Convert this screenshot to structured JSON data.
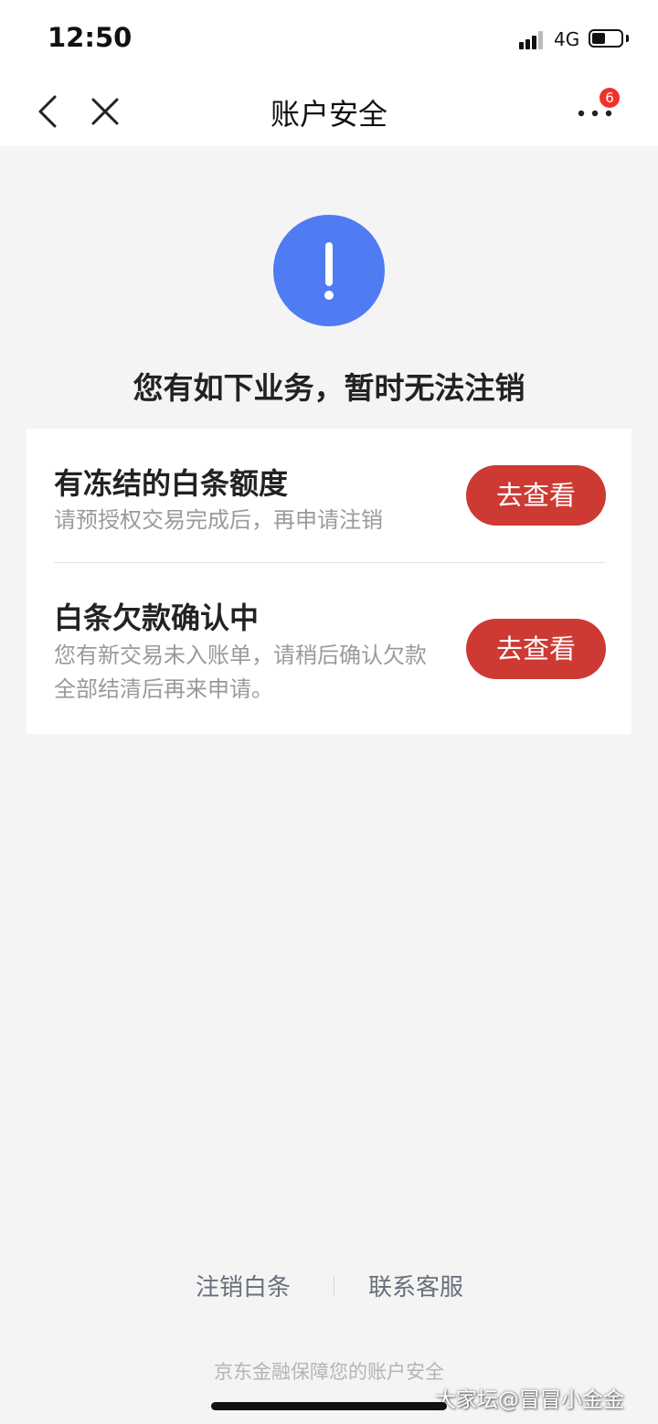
{
  "status_bar": {
    "time": "12:50",
    "network": "4G"
  },
  "nav": {
    "title": "账户安全",
    "badge_count": "6"
  },
  "alert": {
    "icon": "exclamation-icon",
    "icon_color": "#4f7cf2",
    "headline": "您有如下业务，暂时无法注销"
  },
  "items": [
    {
      "title": "有冻结的白条额度",
      "desc_lines": [
        "请预授权交易完成后，再申请注销"
      ],
      "action": "去查看"
    },
    {
      "title": "白条欠款确认中",
      "desc_lines": [
        "您有新交易未入账单，请稍后确认欠款",
        "全部结清后再来申请。"
      ],
      "action": "去查看"
    }
  ],
  "footer": {
    "link_cancel": "注销白条",
    "link_service": "联系客服",
    "note": "京东金融保障您的账户安全"
  },
  "watermark": "大家坛@冒冒小金金",
  "colors": {
    "accent_button": "#cc3a33",
    "badge": "#f2302b",
    "background": "#f4f4f4"
  }
}
